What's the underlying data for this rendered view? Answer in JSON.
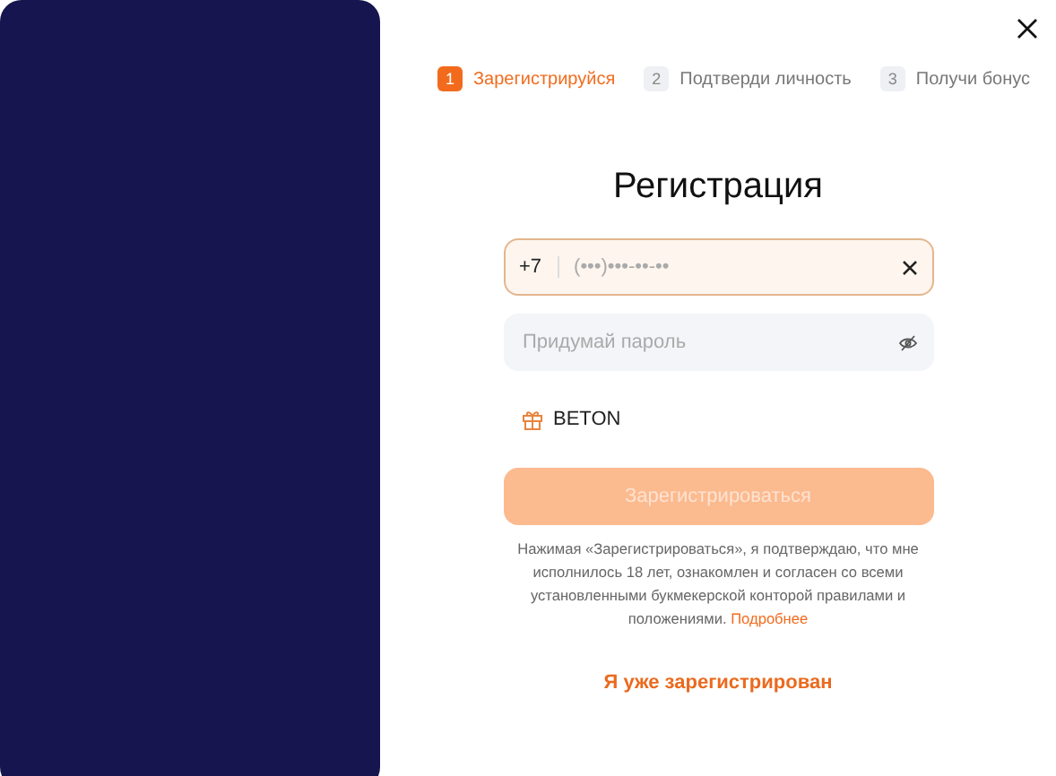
{
  "steps": [
    {
      "number": "1",
      "label": "Зарегистрируйся",
      "selected": true
    },
    {
      "number": "2",
      "label": "Подтверди личность",
      "selected": false
    },
    {
      "number": "3",
      "label": "Получи бонус",
      "selected": false
    }
  ],
  "title": "Регистрация",
  "phone": {
    "prefix": "+7",
    "placeholder": "(•••)•••-••-••",
    "focused": true
  },
  "password": {
    "placeholder": "Придумай пароль"
  },
  "promo": {
    "code": "BETON"
  },
  "submit": {
    "label": "Зарегистрироваться",
    "disabled": true
  },
  "terms": {
    "text": "Нажимая «Зарегистрироваться», я подтверждаю, что мне исполнилось 18 лет, ознакомлен и согласен со всеми установленными букмекерской конторой правилами и положениями.",
    "link": "Подробнее"
  },
  "login_link": "Я уже зарегистрирован"
}
